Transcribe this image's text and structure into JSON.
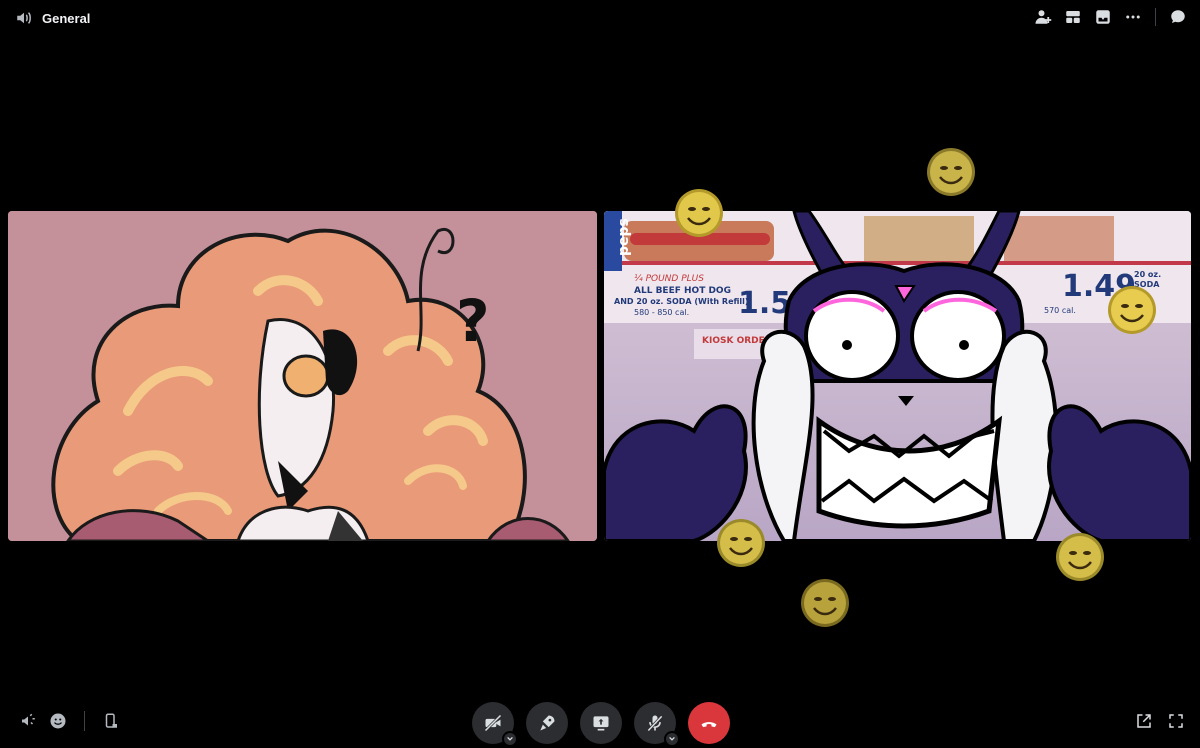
{
  "channel": {
    "name": "General",
    "icon": "speaker-icon"
  },
  "top_actions": [
    {
      "name": "add-friend-icon"
    },
    {
      "name": "layout-grid-icon"
    },
    {
      "name": "inbox-icon"
    },
    {
      "name": "more-icon"
    },
    {
      "name": "chat-icon"
    }
  ],
  "participants": [
    {
      "tile": "left",
      "description": "pink haired character stream"
    },
    {
      "tile": "right",
      "description": "grinning creature stream"
    }
  ],
  "left_tile_art": {
    "question_mark": "?"
  },
  "right_tile_art": {
    "menu_line1": "¼ POUND PLUS",
    "menu_line2": "ALL BEEF HOT DOG",
    "menu_line3": "AND 20 oz. SODA (With Refill)",
    "menu_cal": "580 - 850 cal.",
    "price1": "1.50",
    "price2": "1.49",
    "menu_small1": "20 oz.",
    "menu_small2": "SODA",
    "menu_small3": "570 cal.",
    "menu_sign": "KIOSK ORDER",
    "menu_logo": "peps"
  },
  "controls": [
    {
      "name": "camera-off-button"
    },
    {
      "name": "activity-button"
    },
    {
      "name": "screen-share-button"
    },
    {
      "name": "mute-button"
    },
    {
      "name": "disconnect-button"
    }
  ],
  "colors": {
    "background": "#000000",
    "control_bg": "#2b2d31",
    "end_call": "#da373c"
  }
}
